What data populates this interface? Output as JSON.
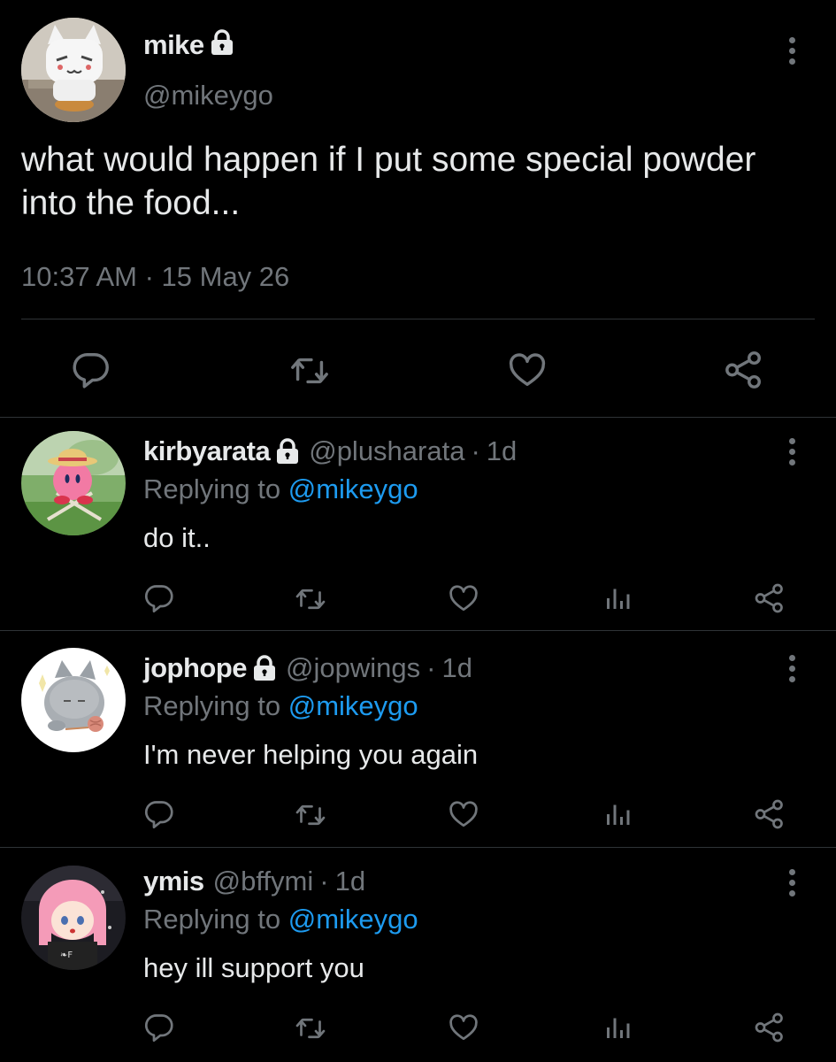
{
  "main_tweet": {
    "name": "mike",
    "handle": "@mikeygo",
    "text": "what would happen if I put some special powder into the food...",
    "timestamp": "10:37 AM · 15 May 26",
    "protected": true
  },
  "replies": [
    {
      "name": "kirbyarata",
      "handle": "@plusharata",
      "separator": "·",
      "time": "1d",
      "protected": true,
      "replying_prefix": "Replying to ",
      "replying_to": "@mikeygo",
      "text": "do it.."
    },
    {
      "name": "jophope",
      "handle": "@jopwings",
      "separator": "·",
      "time": "1d",
      "protected": true,
      "replying_prefix": "Replying to ",
      "replying_to": "@mikeygo",
      "text": "I'm never helping you again"
    },
    {
      "name": "ymis",
      "handle": "@bffymi",
      "separator": "·",
      "time": "1d",
      "protected": false,
      "replying_prefix": "Replying to ",
      "replying_to": "@mikeygo",
      "text": "hey ill support you"
    }
  ],
  "icons": {
    "reply": "reply-icon",
    "retweet": "retweet-icon",
    "like": "heart-icon",
    "views": "views-icon",
    "share": "share-icon",
    "more": "more-icon",
    "lock": "lock-icon"
  },
  "colors": {
    "background": "#000000",
    "text": "#e7e9ea",
    "secondary": "#71767b",
    "mention": "#1d9bf0",
    "divider": "#2f3336"
  }
}
